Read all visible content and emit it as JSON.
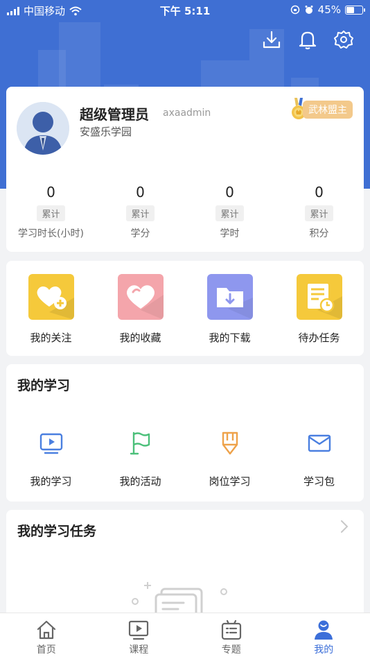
{
  "status_bar": {
    "carrier": "中国移动",
    "time": "下午 5:11",
    "battery": "45%"
  },
  "profile": {
    "name": "超级管理员",
    "username": "axaadmin",
    "school": "安盛乐学园",
    "rank": "武林盟主",
    "stats": [
      {
        "value": "0",
        "tag": "累计",
        "label": "学习时长(小时)"
      },
      {
        "value": "0",
        "tag": "累计",
        "label": "学分"
      },
      {
        "value": "0",
        "tag": "累计",
        "label": "学时"
      },
      {
        "value": "0",
        "tag": "累计",
        "label": "积分"
      }
    ]
  },
  "quick_actions": [
    {
      "label": "我的关注",
      "icon": "heart-plus-icon",
      "color": "#f5c93b"
    },
    {
      "label": "我的收藏",
      "icon": "heart-icon",
      "color": "#f4a5ab"
    },
    {
      "label": "我的下载",
      "icon": "download-folder-icon",
      "color": "#8e97ee"
    },
    {
      "label": "待办任务",
      "icon": "task-doc-icon",
      "color": "#f5c93b"
    }
  ],
  "my_learning": {
    "title": "我的学习",
    "items": [
      {
        "label": "我的学习",
        "icon": "video-screen-icon",
        "color": "#4a7fe0"
      },
      {
        "label": "我的活动",
        "icon": "flag-icon",
        "color": "#4cc07a"
      },
      {
        "label": "岗位学习",
        "icon": "pen-nib-icon",
        "color": "#eea24a"
      },
      {
        "label": "学习包",
        "icon": "envelope-icon",
        "color": "#4a7fe0"
      }
    ]
  },
  "my_tasks": {
    "title": "我的学习任务"
  },
  "tabbar": {
    "tabs": [
      {
        "label": "首页",
        "icon": "home-icon"
      },
      {
        "label": "课程",
        "icon": "play-screen-icon"
      },
      {
        "label": "专题",
        "icon": "topic-icon"
      },
      {
        "label": "我的",
        "icon": "user-icon",
        "active": true
      }
    ]
  },
  "colors": {
    "brand_blue": "#3f6fd3",
    "rank_badge": "#f3c98b",
    "active_tab": "#3c6fd9"
  }
}
